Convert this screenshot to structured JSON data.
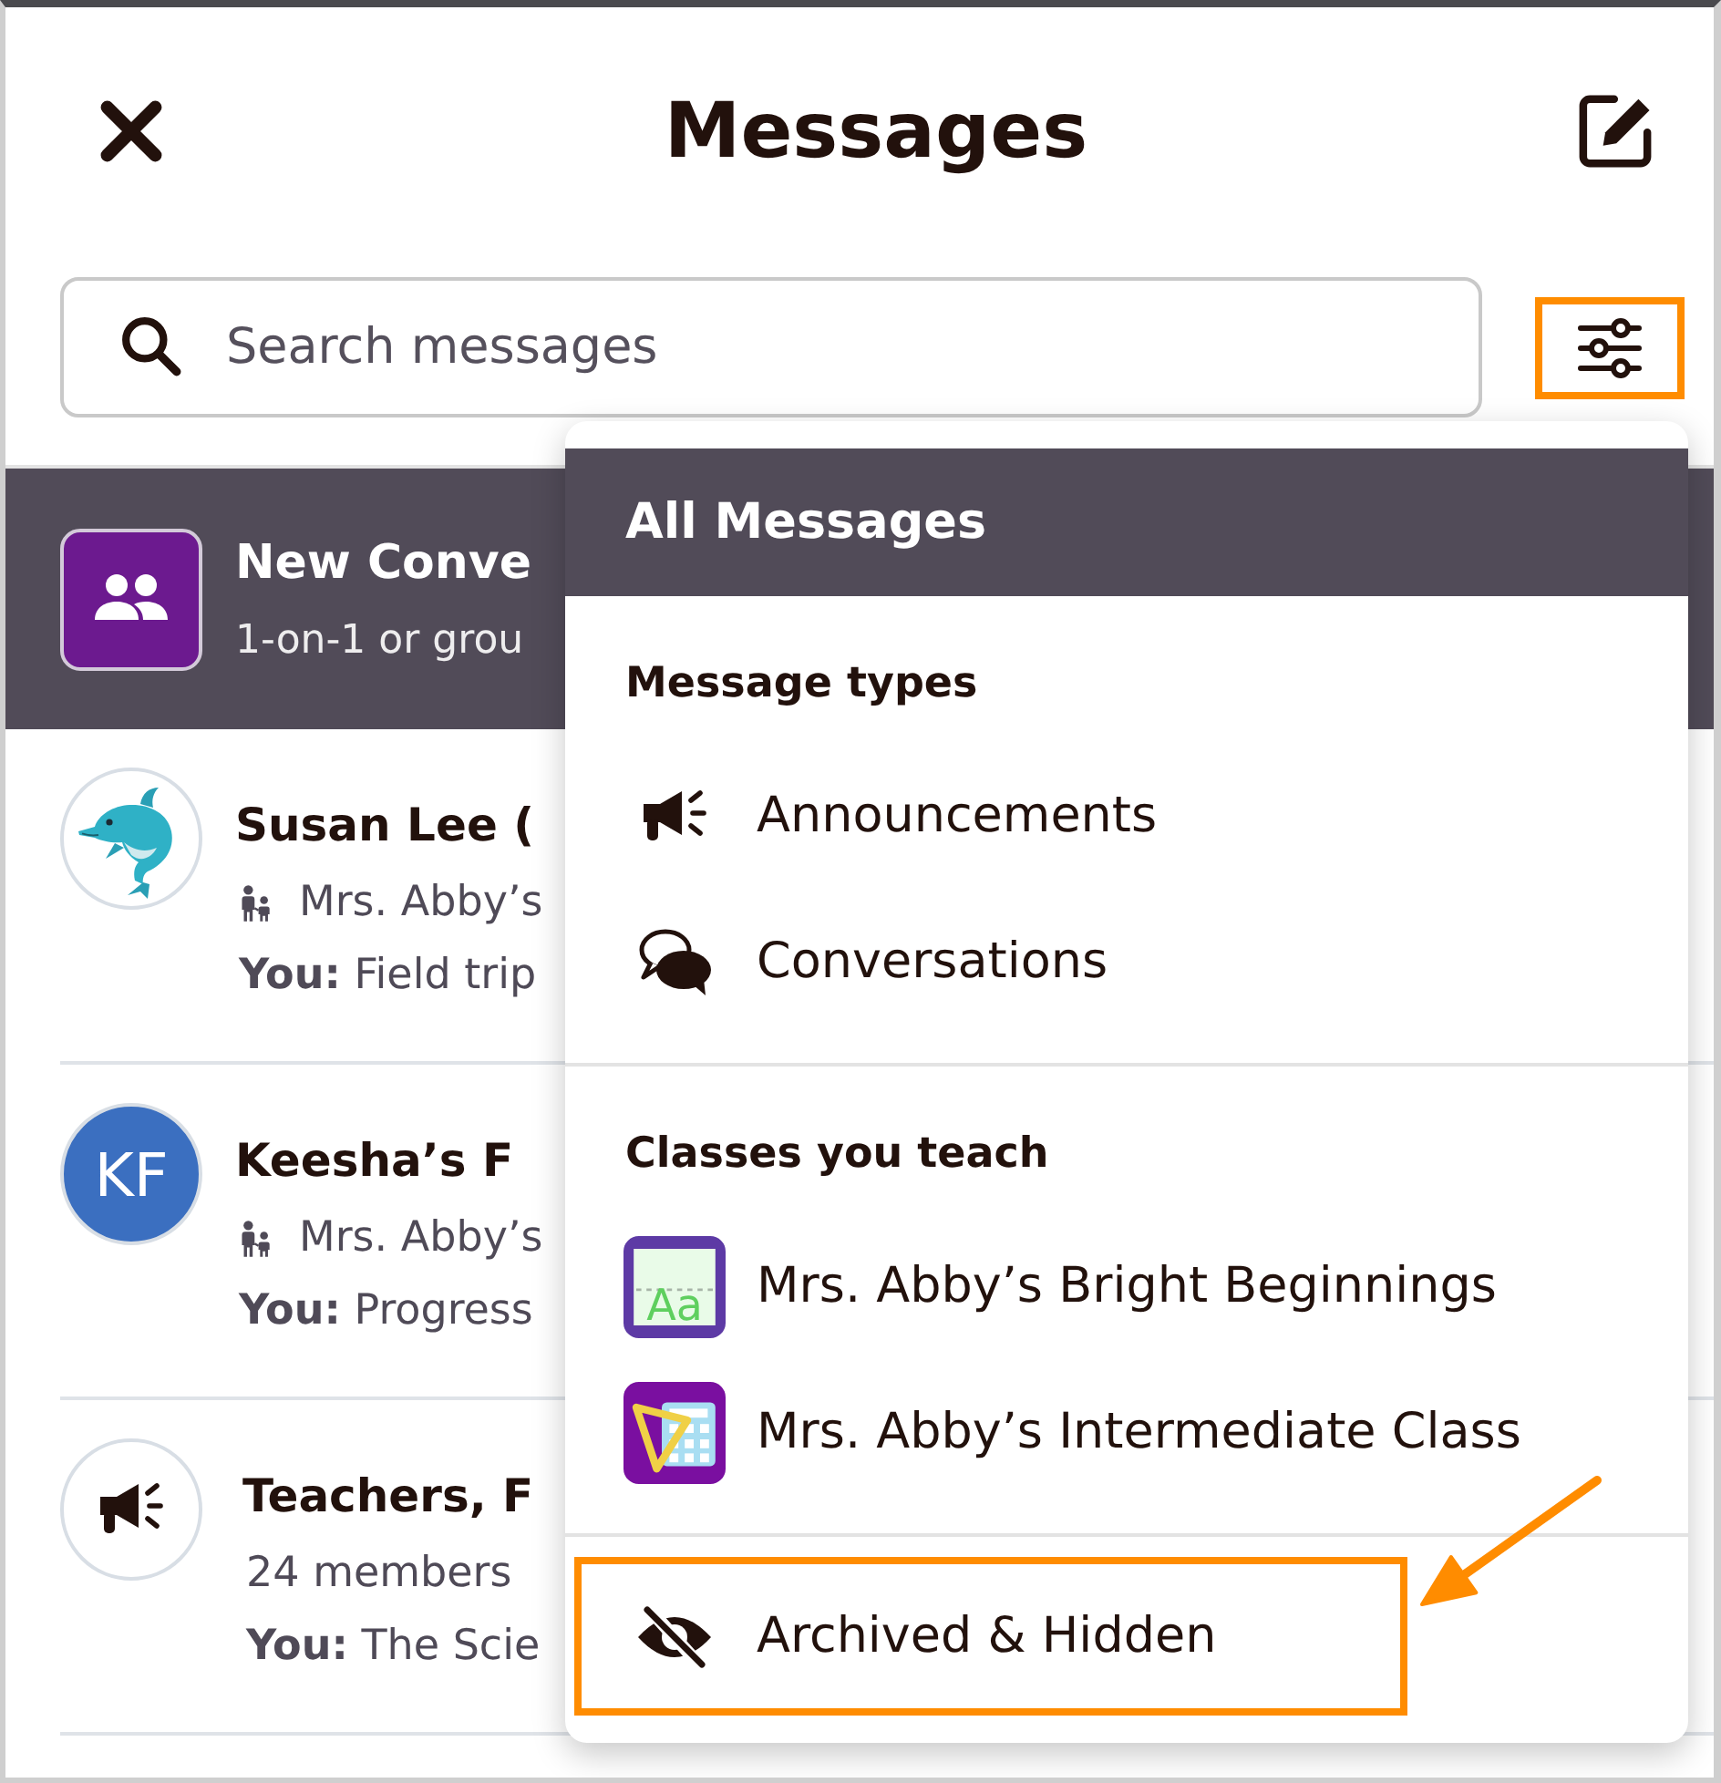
{
  "header": {
    "title": "Messages"
  },
  "search": {
    "placeholder": "Search messages"
  },
  "filter_button": {
    "highlighted": true
  },
  "conversations": [
    {
      "kind": "new",
      "selected": true,
      "title": "New Conve",
      "subtitle": "1-on-1 or grou"
    },
    {
      "kind": "emoji",
      "selected": false,
      "name": "Susan Lee (",
      "class": "Mrs. Abby’s",
      "last_message": "**You:** Field trip"
    },
    {
      "kind": "initials",
      "selected": false,
      "initials": "KF",
      "name": "Keesha’s F",
      "class": "Mrs. Abby’s",
      "last_message": "**You:** Progress"
    },
    {
      "kind": "broadcast",
      "selected": false,
      "name": "Teachers, F",
      "members": "24 members",
      "last_message": "**You:** The Scie"
    }
  ],
  "filter_menu": {
    "top_item": {
      "label": "All Messages",
      "selected": true,
      "highlighted": false
    },
    "sections": [
      {
        "heading": "Message types",
        "items": [
          {
            "kind": "announcements",
            "label": "Announcements",
            "selected": false,
            "highlighted": false
          },
          {
            "kind": "conversations",
            "label": "Conversations",
            "selected": false,
            "highlighted": false
          }
        ]
      },
      {
        "heading": "Classes you teach",
        "items": [
          {
            "kind": "alphabet",
            "label": "Mrs. Abby’s Bright Beginnings",
            "icon_text": "Aa",
            "selected": false,
            "highlighted": false
          },
          {
            "kind": "math",
            "label": "Mrs. Abby’s Intermediate Class",
            "selected": false,
            "highlighted": false
          }
        ]
      }
    ],
    "bottom_item": {
      "kind": "hidden",
      "label": "Archived & Hidden",
      "selected": false,
      "highlighted": true
    }
  }
}
